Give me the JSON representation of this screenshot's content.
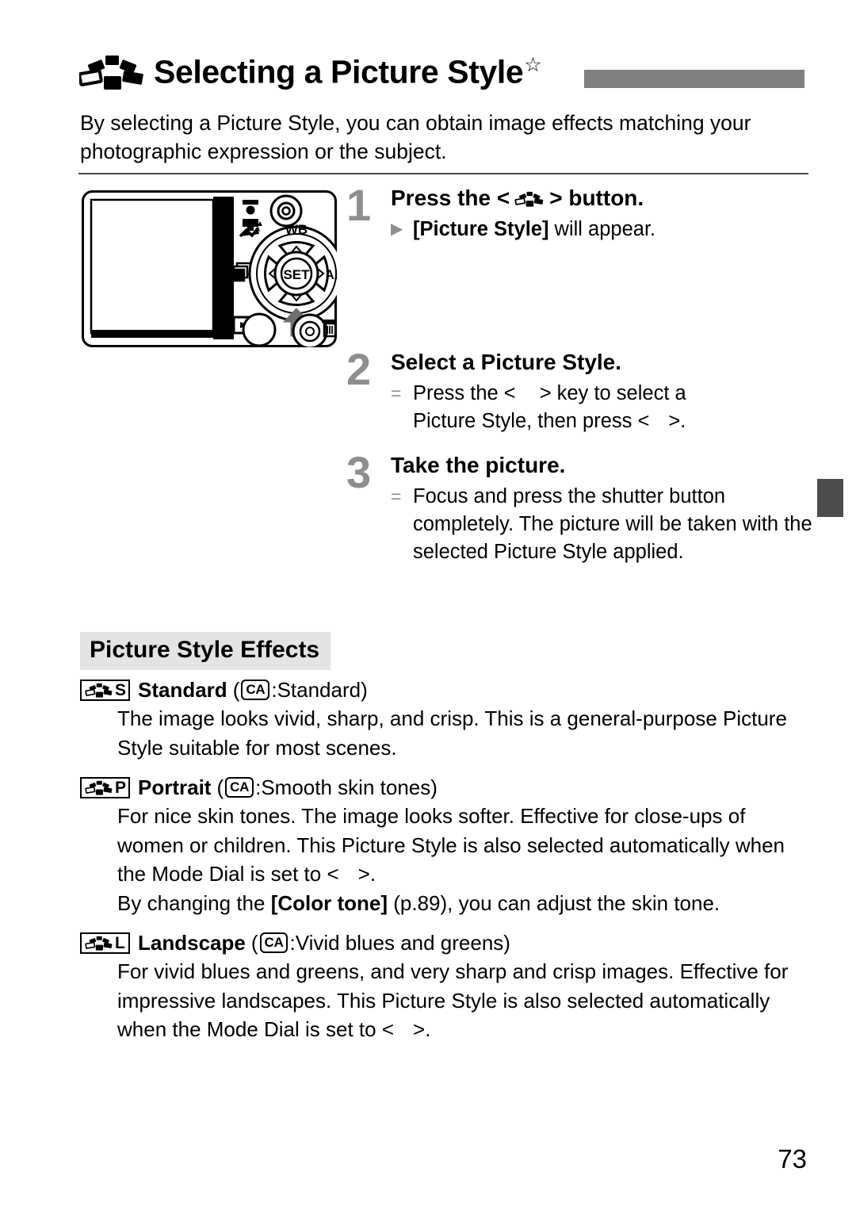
{
  "header": {
    "icon": "picture-style-icon",
    "title": "Selecting a Picture Style",
    "star": "☆"
  },
  "intro": {
    "text": "By selecting a Picture Style, you can obtain image effects matching your photographic expression or the subject."
  },
  "illustration": {
    "name": "camera-back-illustration",
    "labels": {
      "wb": "WB",
      "af": "AF",
      "set": "SET"
    }
  },
  "steps": [
    {
      "number": "1",
      "heading_before": "Press the <",
      "heading_icon": "picture-style-icon",
      "heading_after": "> button.",
      "bullets": [
        {
          "mark": "▶",
          "mark_type": "triangle",
          "bold": "[Picture Style]",
          "rest": " will appear."
        }
      ]
    },
    {
      "number": "2",
      "heading": "Select a Picture Style.",
      "bullets": [
        {
          "mark": "=",
          "mark_type": "equals",
          "line1_a": "Press the <",
          "line1_b": "> key to select a",
          "line2_a": "Picture Style, then press <",
          "line2_b": ">."
        }
      ]
    },
    {
      "number": "3",
      "heading": "Take the picture.",
      "bullets": [
        {
          "mark": "=",
          "mark_type": "equals",
          "text": "Focus and press the shutter button completely. The picture will be taken with the selected Picture Style applied."
        }
      ]
    }
  ],
  "effects_section": {
    "heading": "Picture Style Effects",
    "items": [
      {
        "badge_letter": "S",
        "name": "Standard",
        "paren_open": "(",
        "mode_icon": "CA",
        "paren_mid": ": ",
        "mode_desc": "Standard",
        "paren_close": ")",
        "description": "The image looks vivid, sharp, and crisp. This is a general-purpose Picture Style suitable for most scenes."
      },
      {
        "badge_letter": "P",
        "name": "Portrait",
        "paren_open": "(",
        "mode_icon": "CA",
        "paren_mid": ": ",
        "mode_desc": "Smooth skin tones",
        "paren_close": ")",
        "description_a": "For nice skin tones. The image looks softer. Effective for close-ups of women or children. This Picture Style is also selected automatically when the Mode Dial is set to <",
        "description_b": ">.",
        "description_line2_a": "By changing the ",
        "description_line2_bold": "[Color tone]",
        "description_line2_b": " (p.89), you can adjust the skin tone."
      },
      {
        "badge_letter": "L",
        "name": "Landscape",
        "paren_open": "(",
        "mode_icon": "CA",
        "paren_mid": ": ",
        "mode_desc": "Vivid blues and greens",
        "paren_close": ")",
        "description_a": "For vivid blues and greens, and very sharp and crisp images. Effective for impressive landscapes. This Picture Style is also selected automatically when the Mode Dial is set to <",
        "description_b": ">."
      }
    ]
  },
  "page_number": "73",
  "colors": {
    "header_bar": "#808080",
    "step_number": "#8e8e8e",
    "effects_heading_bg": "#e4e4e4",
    "side_tab": "#4d4d4d",
    "rule": "#4a4a4a"
  }
}
